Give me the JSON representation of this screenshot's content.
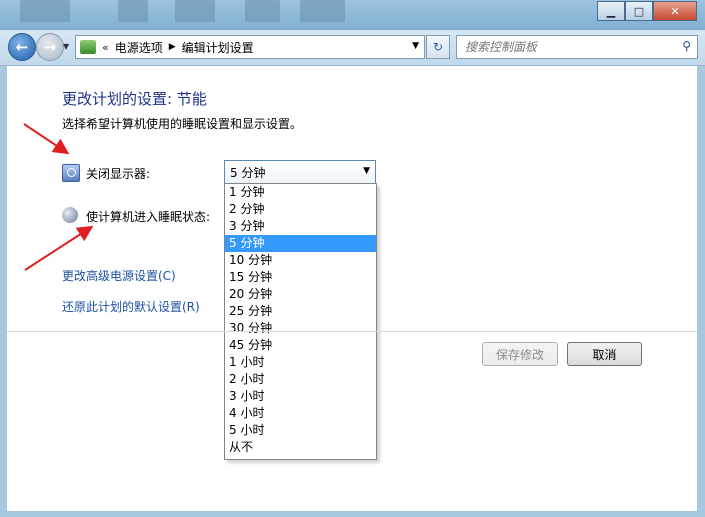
{
  "navigation": {
    "breadcrumb_prefix": "«",
    "breadcrumbs": [
      "电源选项",
      "编辑计划设置"
    ],
    "search_placeholder": "搜索控制面板"
  },
  "main": {
    "title": "更改计划的设置: 节能",
    "subtitle": "选择希望计算机使用的睡眠设置和显示设置。",
    "display_off_label": "关闭显示器:",
    "sleep_label": "使计算机进入睡眠状态:",
    "display_off_value": "5 分钟",
    "dropdown_options": [
      "1 分钟",
      "2 分钟",
      "3 分钟",
      "5 分钟",
      "10 分钟",
      "15 分钟",
      "20 分钟",
      "25 分钟",
      "30 分钟",
      "45 分钟",
      "1 小时",
      "2 小时",
      "3 小时",
      "4 小时",
      "5 小时",
      "从不"
    ],
    "selected_option": "5 分钟",
    "link_advanced": "更改高级电源设置(C)",
    "link_restore": "还原此计划的默认设置(R)"
  },
  "buttons": {
    "save": "保存修改",
    "cancel": "取消"
  },
  "icons": {
    "back": "back-arrow-icon",
    "forward": "forward-arrow-icon",
    "refresh": "refresh-icon",
    "search": "search-icon",
    "monitor": "monitor-clock-icon",
    "sleep": "moon-icon"
  },
  "colors": {
    "title": "#1e3287",
    "link": "#1e50a2",
    "selection": "#3399ff",
    "annotation_arrow": "#e02020"
  }
}
